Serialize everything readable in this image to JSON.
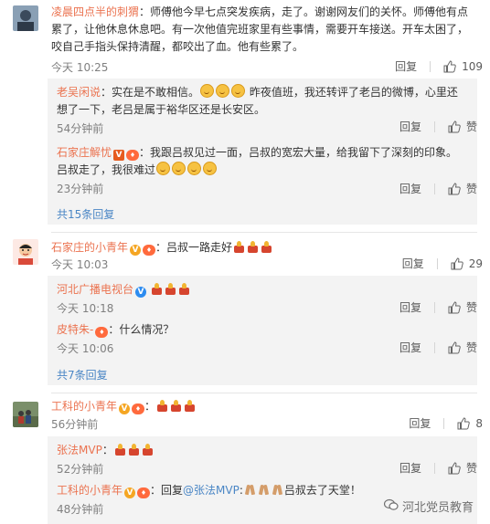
{
  "colors": {
    "name": "#eb7350",
    "more": "#4a86c5",
    "reply_bg": "#f3f3f3",
    "badge_gold": "#f5a623",
    "badge_blue": "#2d8cf0"
  },
  "actions": {
    "reply": "回复",
    "like": "赞"
  },
  "c1": {
    "author": "凌晨四点半的刺猬",
    "text": "：师傅他今早七点突发疾病，走了。谢谢网友们的关怀。师傅他有点累了，让他休息休息吧。有一次他值完班家里有些事情，需要开车接送。开车太困了，咬自己手指头保持清醒，都咬出了血。他有些累了。",
    "time": "今天 10:25",
    "likes": "109",
    "replies": [
      {
        "author": "老吴闲说",
        "text_a": "：实在是不敢相信。",
        "text_b": "昨夜值班，我还转评了老吕的微博，心里还想了一下，老吕是属于裕华区还是长安区。",
        "time": "54分钟前"
      },
      {
        "author": "石家庄解忧",
        "text_a": "：我跟吕叔见过一面，吕叔的宽宏大量，给我留下了深刻的印象。吕叔走了，我很难过",
        "time": "23分钟前"
      }
    ],
    "more": "共15条回复"
  },
  "c2": {
    "author": "石家庄的小青年",
    "text": "：吕叔一路走好",
    "time": "今天 10:03",
    "likes": "29",
    "replies": [
      {
        "author": "河北广播电视台",
        "time": "今天 10:18"
      },
      {
        "author": "皮特朱-",
        "text": "：什么情况？",
        "time": "今天 10:06"
      }
    ],
    "more": "共7条回复"
  },
  "c3": {
    "author": "工科的小青年",
    "time": "56分钟前",
    "likes": "8",
    "replies": [
      {
        "author": "张法MVP",
        "time": "52分钟前"
      },
      {
        "author": "工科的小青年",
        "text_a": "：回复",
        "mention": "@张法MVP",
        "text_b": ":",
        "text_c": "吕叔去了天堂！",
        "time": "48分钟前"
      }
    ]
  },
  "watermark": "河北党员教育"
}
